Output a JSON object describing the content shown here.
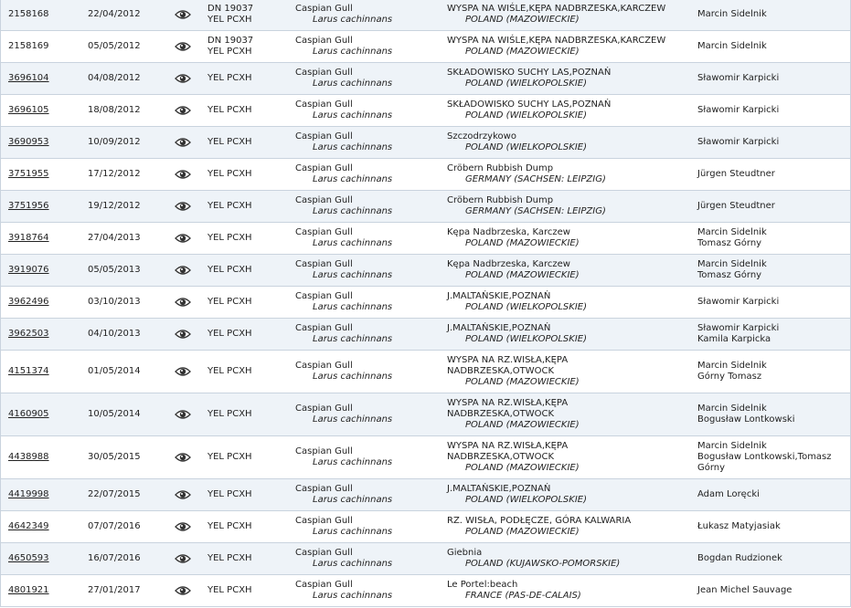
{
  "rows": [
    {
      "id": "2158168",
      "date": "22/04/2012",
      "rings": [
        "DN 19037",
        "YEL PCXH"
      ],
      "species": "Caspian Gull",
      "latin": "Larus cachinnans",
      "place": [
        "WYSPA NA WIŚLE,KĘPA NADBRZESKA,KARCZEW"
      ],
      "country": "POLAND (MAZOWIECKIE)",
      "observers": [
        "Marcin Sidelnik"
      ],
      "link": false
    },
    {
      "id": "2158169",
      "date": "05/05/2012",
      "rings": [
        "DN 19037",
        "YEL PCXH"
      ],
      "species": "Caspian Gull",
      "latin": "Larus cachinnans",
      "place": [
        "WYSPA NA WIŚLE,KĘPA NADBRZESKA,KARCZEW"
      ],
      "country": "POLAND (MAZOWIECKIE)",
      "observers": [
        "Marcin Sidelnik"
      ],
      "link": false
    },
    {
      "id": "3696104",
      "date": "04/08/2012",
      "rings": [
        "YEL PCXH"
      ],
      "species": "Caspian Gull",
      "latin": "Larus cachinnans",
      "place": [
        "SKŁADOWISKO SUCHY LAS,POZNAŃ"
      ],
      "country": "POLAND (WIELKOPOLSKIE)",
      "observers": [
        "Sławomir Karpicki"
      ],
      "link": true
    },
    {
      "id": "3696105",
      "date": "18/08/2012",
      "rings": [
        "YEL PCXH"
      ],
      "species": "Caspian Gull",
      "latin": "Larus cachinnans",
      "place": [
        "SKŁADOWISKO SUCHY LAS,POZNAŃ"
      ],
      "country": "POLAND (WIELKOPOLSKIE)",
      "observers": [
        "Sławomir Karpicki"
      ],
      "link": true
    },
    {
      "id": "3690953",
      "date": "10/09/2012",
      "rings": [
        "YEL PCXH"
      ],
      "species": "Caspian Gull",
      "latin": "Larus cachinnans",
      "place": [
        "Szczodrzykowo"
      ],
      "country": "POLAND (WIELKOPOLSKIE)",
      "observers": [
        "Sławomir Karpicki"
      ],
      "link": true
    },
    {
      "id": "3751955",
      "date": "17/12/2012",
      "rings": [
        "YEL PCXH"
      ],
      "species": "Caspian Gull",
      "latin": "Larus cachinnans",
      "place": [
        "Cröbern Rubbish Dump"
      ],
      "country": "GERMANY (SACHSEN: LEIPZIG)",
      "observers": [
        "Jürgen Steudtner"
      ],
      "link": true
    },
    {
      "id": "3751956",
      "date": "19/12/2012",
      "rings": [
        "YEL PCXH"
      ],
      "species": "Caspian Gull",
      "latin": "Larus cachinnans",
      "place": [
        "Cröbern Rubbish Dump"
      ],
      "country": "GERMANY (SACHSEN: LEIPZIG)",
      "observers": [
        "Jürgen Steudtner"
      ],
      "link": true
    },
    {
      "id": "3918764",
      "date": "27/04/2013",
      "rings": [
        "YEL PCXH"
      ],
      "species": "Caspian Gull",
      "latin": "Larus cachinnans",
      "place": [
        "Kępa Nadbrzeska, Karczew"
      ],
      "country": "POLAND (MAZOWIECKIE)",
      "observers": [
        "Marcin Sidelnik",
        "Tomasz Górny"
      ],
      "link": true
    },
    {
      "id": "3919076",
      "date": "05/05/2013",
      "rings": [
        "YEL PCXH"
      ],
      "species": "Caspian Gull",
      "latin": "Larus cachinnans",
      "place": [
        "Kępa Nadbrzeska, Karczew"
      ],
      "country": "POLAND (MAZOWIECKIE)",
      "observers": [
        "Marcin Sidelnik",
        "Tomasz Górny"
      ],
      "link": true
    },
    {
      "id": "3962496",
      "date": "03/10/2013",
      "rings": [
        "YEL PCXH"
      ],
      "species": "Caspian Gull",
      "latin": "Larus cachinnans",
      "place": [
        "J.MALTAŃSKIE,POZNAŃ"
      ],
      "country": "POLAND (WIELKOPOLSKIE)",
      "observers": [
        "Sławomir Karpicki"
      ],
      "link": true
    },
    {
      "id": "3962503",
      "date": "04/10/2013",
      "rings": [
        "YEL PCXH"
      ],
      "species": "Caspian Gull",
      "latin": "Larus cachinnans",
      "place": [
        "J.MALTAŃSKIE,POZNAŃ"
      ],
      "country": "POLAND (WIELKOPOLSKIE)",
      "observers": [
        "Sławomir Karpicki",
        "Kamila Karpicka"
      ],
      "link": true
    },
    {
      "id": "4151374",
      "date": "01/05/2014",
      "rings": [
        "YEL PCXH"
      ],
      "species": "Caspian Gull",
      "latin": "Larus cachinnans",
      "place": [
        "WYSPA NA RZ.WISŁA,KĘPA",
        "NADBRZESKA,OTWOCK"
      ],
      "country": "POLAND (MAZOWIECKIE)",
      "observers": [
        "Marcin Sidelnik",
        "Górny Tomasz"
      ],
      "link": true
    },
    {
      "id": "4160905",
      "date": "10/05/2014",
      "rings": [
        "YEL PCXH"
      ],
      "species": "Caspian Gull",
      "latin": "Larus cachinnans",
      "place": [
        "WYSPA NA RZ.WISŁA,KĘPA",
        "NADBRZESKA,OTWOCK"
      ],
      "country": "POLAND (MAZOWIECKIE)",
      "observers": [
        "Marcin Sidelnik",
        "Bogusław Lontkowski"
      ],
      "link": true
    },
    {
      "id": "4438988",
      "date": "30/05/2015",
      "rings": [
        "YEL PCXH"
      ],
      "species": "Caspian Gull",
      "latin": "Larus cachinnans",
      "place": [
        "WYSPA NA RZ.WISŁA,KĘPA",
        "NADBRZESKA,OTWOCK"
      ],
      "country": "POLAND (MAZOWIECKIE)",
      "observers": [
        "Marcin Sidelnik",
        "Bogusław Lontkowski,Tomasz",
        "Górny"
      ],
      "link": true
    },
    {
      "id": "4419998",
      "date": "22/07/2015",
      "rings": [
        "YEL PCXH"
      ],
      "species": "Caspian Gull",
      "latin": "Larus cachinnans",
      "place": [
        "J.MALTAŃSKIE,POZNAŃ"
      ],
      "country": "POLAND (WIELKOPOLSKIE)",
      "observers": [
        "Adam Loręcki"
      ],
      "link": true
    },
    {
      "id": "4642349",
      "date": "07/07/2016",
      "rings": [
        "YEL PCXH"
      ],
      "species": "Caspian Gull",
      "latin": "Larus cachinnans",
      "place": [
        "RZ. WISŁA, PODŁĘCZE, GÓRA KALWARIA"
      ],
      "country": "POLAND (MAZOWIECKIE)",
      "observers": [
        "Łukasz Matyjasiak"
      ],
      "link": true
    },
    {
      "id": "4650593",
      "date": "16/07/2016",
      "rings": [
        "YEL PCXH"
      ],
      "species": "Caspian Gull",
      "latin": "Larus cachinnans",
      "place": [
        "Giebnia"
      ],
      "country": "POLAND (KUJAWSKO-POMORSKIE)",
      "observers": [
        "Bogdan Rudzionek"
      ],
      "link": true
    },
    {
      "id": "4801921",
      "date": "27/01/2017",
      "rings": [
        "YEL PCXH"
      ],
      "species": "Caspian Gull",
      "latin": "Larus cachinnans",
      "place": [
        "Le Portel:beach"
      ],
      "country": "FRANCE (PAS-DE-CALAIS)",
      "observers": [
        "Jean Michel Sauvage"
      ],
      "link": true
    }
  ],
  "icons": {
    "view": "eye-icon"
  },
  "colors": {
    "row_alt": "#eef3f8",
    "border": "#c9d3de"
  }
}
